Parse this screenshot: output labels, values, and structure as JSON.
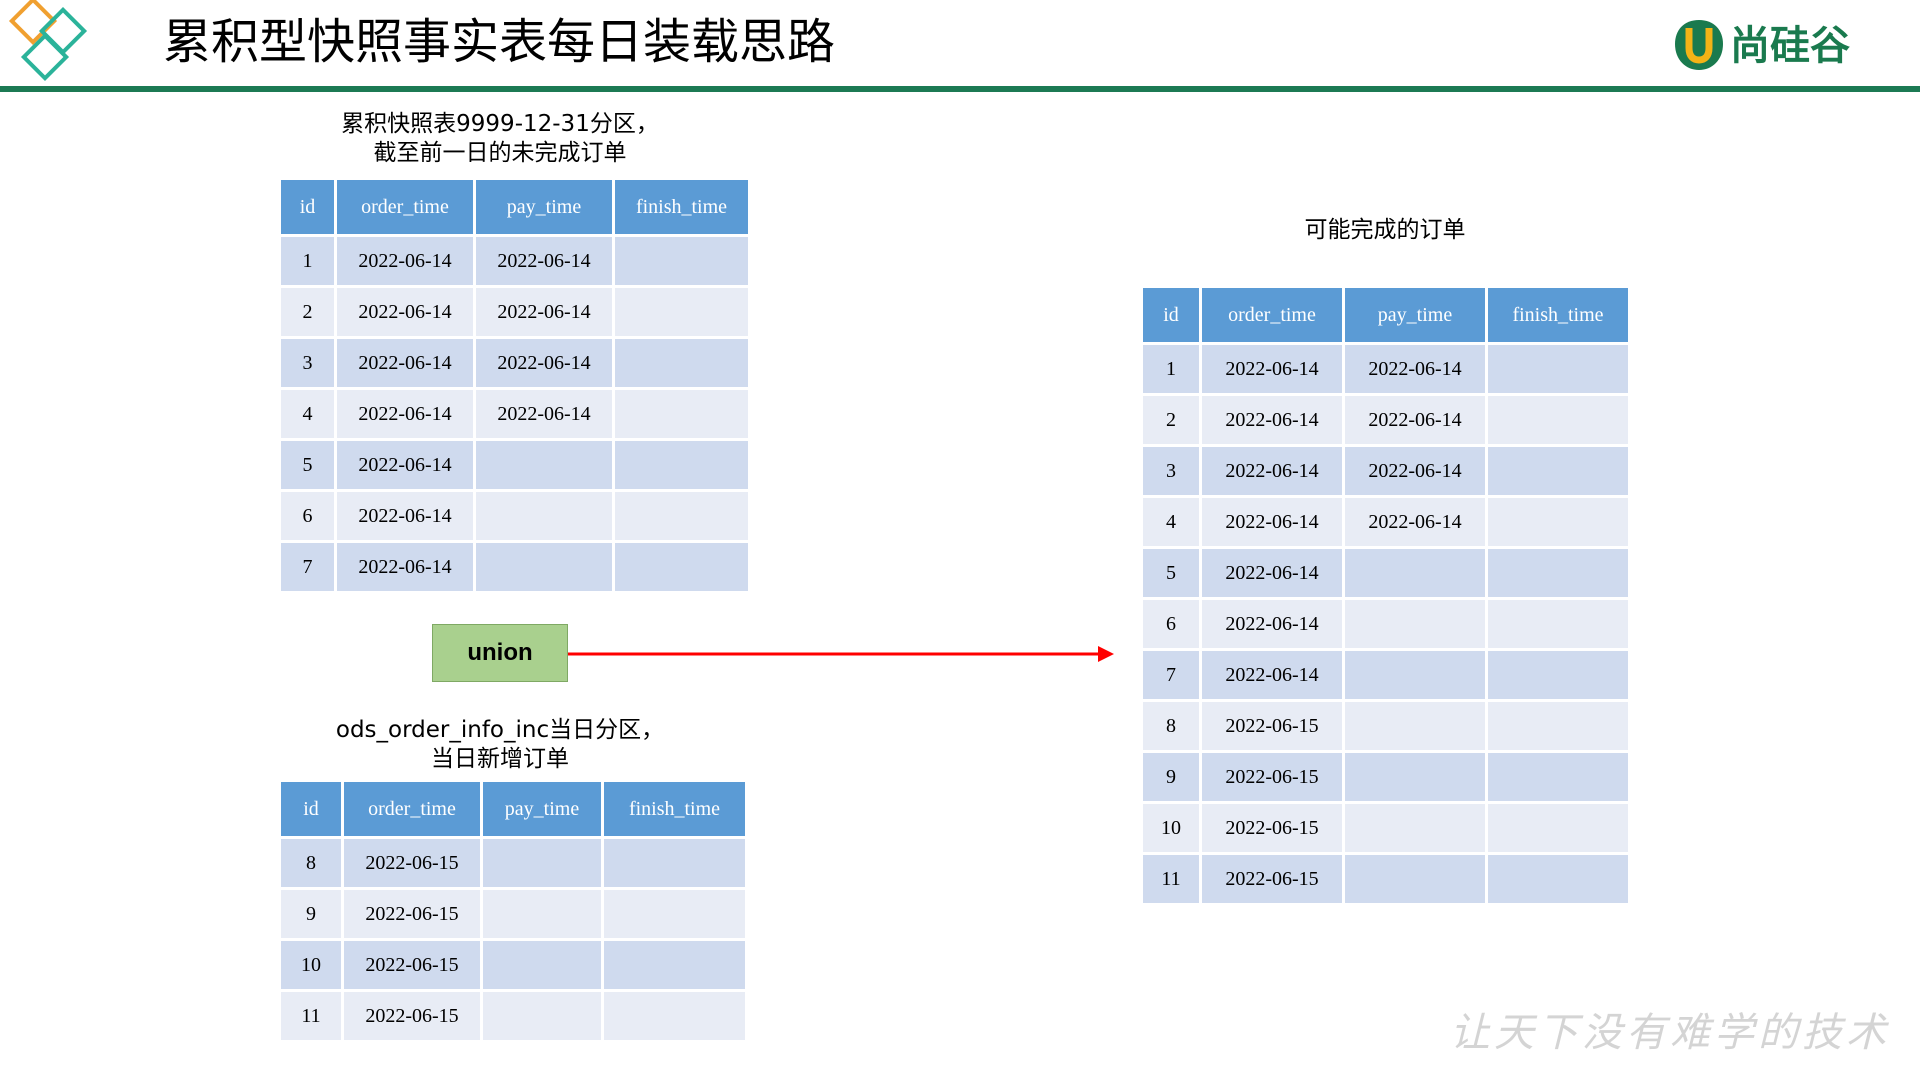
{
  "title": "累积型快照事实表每日装载思路",
  "brand": {
    "name": "尚硅谷",
    "logo_icon": "u-badge-icon",
    "color": "#1a7a4e"
  },
  "slogan": "让天下没有难学的技术",
  "top_table": {
    "caption_line1": "累积快照表9999-12-31分区，",
    "caption_line2": "截至前一日的未完成订单",
    "headers": [
      "id",
      "order_time",
      "pay_time",
      "finish_time"
    ],
    "rows": [
      [
        "1",
        "2022-06-14",
        "2022-06-14",
        ""
      ],
      [
        "2",
        "2022-06-14",
        "2022-06-14",
        ""
      ],
      [
        "3",
        "2022-06-14",
        "2022-06-14",
        ""
      ],
      [
        "4",
        "2022-06-14",
        "2022-06-14",
        ""
      ],
      [
        "5",
        "2022-06-14",
        "",
        ""
      ],
      [
        "6",
        "2022-06-14",
        "",
        ""
      ],
      [
        "7",
        "2022-06-14",
        "",
        ""
      ]
    ]
  },
  "bottom_table": {
    "caption_line1": "ods_order_info_inc当日分区，",
    "caption_line2": "当日新增订单",
    "headers": [
      "id",
      "order_time",
      "pay_time",
      "finish_time"
    ],
    "rows": [
      [
        "8",
        "2022-06-15",
        "",
        ""
      ],
      [
        "9",
        "2022-06-15",
        "",
        ""
      ],
      [
        "10",
        "2022-06-15",
        "",
        ""
      ],
      [
        "11",
        "2022-06-15",
        "",
        ""
      ]
    ]
  },
  "result_table": {
    "caption": "可能完成的订单",
    "headers": [
      "id",
      "order_time",
      "pay_time",
      "finish_time"
    ],
    "rows": [
      [
        "1",
        "2022-06-14",
        "2022-06-14",
        ""
      ],
      [
        "2",
        "2022-06-14",
        "2022-06-14",
        ""
      ],
      [
        "3",
        "2022-06-14",
        "2022-06-14",
        ""
      ],
      [
        "4",
        "2022-06-14",
        "2022-06-14",
        ""
      ],
      [
        "5",
        "2022-06-14",
        "",
        ""
      ],
      [
        "6",
        "2022-06-14",
        "",
        ""
      ],
      [
        "7",
        "2022-06-14",
        "",
        ""
      ],
      [
        "8",
        "2022-06-15",
        "",
        ""
      ],
      [
        "9",
        "2022-06-15",
        "",
        ""
      ],
      [
        "10",
        "2022-06-15",
        "",
        ""
      ],
      [
        "11",
        "2022-06-15",
        "",
        ""
      ]
    ]
  },
  "union_label": "union",
  "colors": {
    "header": "#5b9bd5",
    "row_odd": "#cfdaee",
    "row_even": "#e8ecf5",
    "union_box": "#a9d08e",
    "arrow": "#ff0000",
    "rule": "#1c7a54"
  }
}
